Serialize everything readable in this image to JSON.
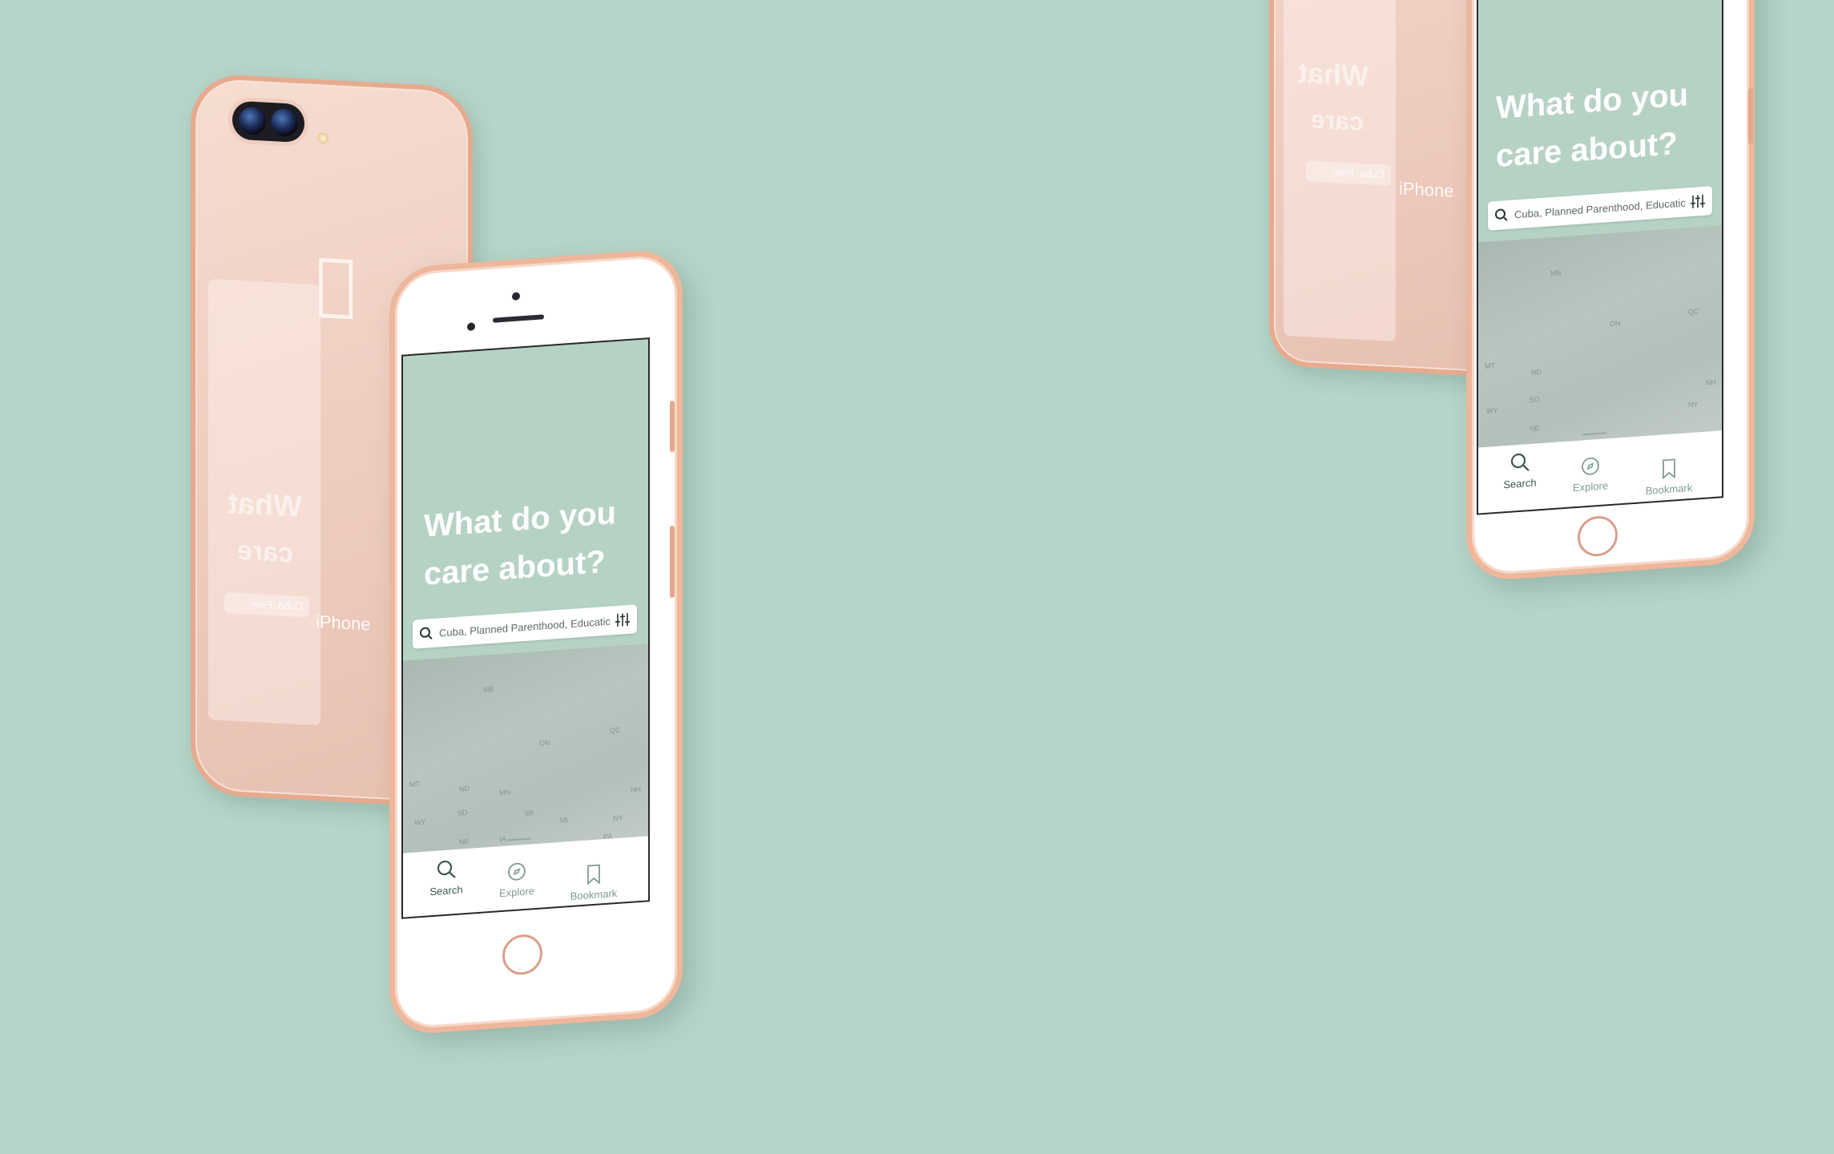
{
  "colors": {
    "background": "#b6d4c8",
    "app_teal": "#b6d2c5",
    "rose_gold": "#eeb69b",
    "tab_active": "#3e5a52",
    "tab_inactive": "#7f9b92"
  },
  "device_back": {
    "brand": "iPhone",
    "logo_icon": "apple-logo-icon",
    "mirrored_headline": [
      "What",
      "care"
    ],
    "mirrored_search": "Cuba, Plan"
  },
  "app": {
    "headline_line1": "What do you",
    "headline_line2": "care about?",
    "search": {
      "placeholder": "Cuba, Planned Parenthood, Education...",
      "search_icon": "search-icon",
      "filter_icon": "sliders-icon"
    },
    "map_labels": [
      "MB",
      "ON",
      "QC",
      "MT",
      "ND",
      "MN",
      "SD",
      "WY",
      "NE",
      "IA",
      "NY",
      "PA",
      "NH",
      "WI",
      "MI"
    ],
    "tabs": [
      {
        "label": "Search",
        "icon": "search-icon",
        "active": true
      },
      {
        "label": "Explore",
        "icon": "compass-icon",
        "active": false
      },
      {
        "label": "Bookmark",
        "icon": "bookmark-icon",
        "active": false
      }
    ]
  }
}
